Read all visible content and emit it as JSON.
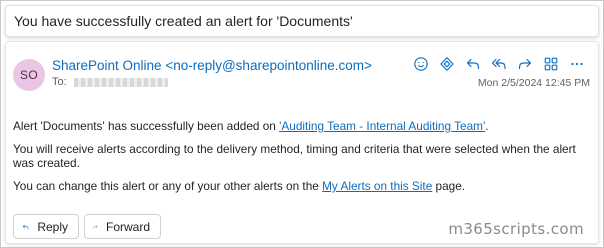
{
  "subject": "You have successfully created an alert for 'Documents'",
  "message": {
    "avatar_initials": "SO",
    "sender": "SharePoint Online <no-reply@sharepointonline.com>",
    "to_label": "To:",
    "date": "Mon 2/5/2024 12:45 PM",
    "actions": [
      "emoji-icon",
      "copilot-icon",
      "reply-icon",
      "reply-all-icon",
      "forward-icon",
      "apps-icon",
      "more-icon"
    ]
  },
  "body": {
    "p1_before": "Alert 'Documents' has successfully been added on ",
    "p1_link": "'Auditing Team - Internal Auditing Team'",
    "p1_after": ".",
    "p2": "You will receive alerts according to the delivery method, timing and criteria that were selected when the alert was created.",
    "p3_before": "You can change this alert or any of your other alerts on the ",
    "p3_link": "My Alerts on this Site",
    "p3_after": " page."
  },
  "buttons": {
    "reply": "Reply",
    "forward": "Forward"
  },
  "watermark": "m365scripts.com",
  "colors": {
    "accent": "#0f6cbd",
    "avatar_bg": "#e9c7e4"
  }
}
